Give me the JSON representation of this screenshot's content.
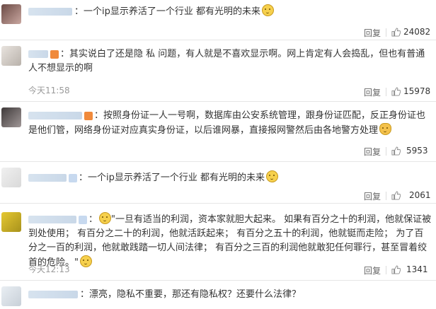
{
  "comments": [
    {
      "text": "一个ip显示养活了一个行业 都有光明的未来",
      "reply_label": "回复",
      "likes": "24082"
    },
    {
      "text": "其实说白了还是隐 私 问题，有人就是不喜欢显示啊。网上肯定有人会捣乱，但也有普通人不想显示的啊",
      "time": "今天11:58",
      "reply_label": "回复",
      "likes": "15978"
    },
    {
      "text": "按照身份证一人一号啊，数据库由公安系统管理，跟身份证匹配，反正身份证也是他们管，网络身份证对应真实身份证，以后谁网暴，直接报网警然后由各地警方处理",
      "reply_label": "回复",
      "likes": "5953"
    },
    {
      "text": "一个ip显示养活了一个行业 都有光明的未来",
      "reply_label": "回复",
      "likes": "2061"
    },
    {
      "text": "\"一旦有适当的利润，资本家就胆大起来。 如果有百分之十的利润，他就保证被到处使用； 有百分之二十的利润，他就活跃起来； 有百分之五十的利润，他就铤而走险； 为了百分之一百的利润，他就敢践踏一切人间法律； 有百分之三百的利润他就敢犯任何罪行，甚至冒着绞首的危险。\"",
      "time": "今天12:13",
      "reply_label": "回复",
      "likes": "1341"
    },
    {
      "text": "漂亮，隐私不重要，那还有隐私权？还要什么法律？"
    }
  ]
}
